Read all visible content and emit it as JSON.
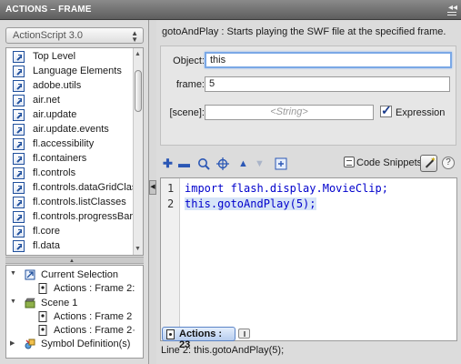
{
  "window": {
    "title": "ACTIONS – FRAME",
    "close_glyph": "◂◂",
    "menu_icon": "panel-menu-icon"
  },
  "left": {
    "language_select": {
      "value": "ActionScript 3.0"
    },
    "library": [
      {
        "label": "Top Level"
      },
      {
        "label": "Language Elements"
      },
      {
        "label": "adobe.utils"
      },
      {
        "label": "air.net"
      },
      {
        "label": "air.update"
      },
      {
        "label": "air.update.events"
      },
      {
        "label": "fl.accessibility"
      },
      {
        "label": "fl.containers"
      },
      {
        "label": "fl.controls"
      },
      {
        "label": "fl.controls.dataGridClas"
      },
      {
        "label": "fl.controls.listClasses"
      },
      {
        "label": "fl.controls.progressBar"
      },
      {
        "label": "fl.core"
      },
      {
        "label": "fl.data"
      }
    ],
    "script_navigator": {
      "current_selection": "Current Selection",
      "current_item": "Actions : Frame 2:",
      "scene": "Scene 1",
      "scene_items": [
        "Actions : Frame 2",
        "Actions : Frame 2·"
      ],
      "symbols": "Symbol Definition(s)"
    }
  },
  "right": {
    "description": "gotoAndPlay : Starts playing the SWF file at the specified frame.",
    "params": {
      "object_label": "Object:",
      "object_value": "this",
      "frame_label": "frame:",
      "frame_value": "5",
      "scene_label": "[scene]:",
      "scene_placeholder": "<String>",
      "expression_label": "Expression",
      "expression_checked": true
    },
    "toolbar": {
      "add_icon": "add-statement-icon",
      "remove_icon": "remove-statement-icon",
      "find_icon": "find-icon",
      "target_icon": "insert-target-path-icon",
      "up_icon": "move-up-icon",
      "down_icon": "move-down-icon",
      "script_assist_icon": "script-assist-icon",
      "snippets_label": "Code Snippets"
    },
    "code": {
      "lines": [
        {
          "num": "1",
          "text": "import flash.display.MovieClip;"
        },
        {
          "num": "2",
          "text": "this.gotoAndPlay(5);"
        }
      ]
    },
    "tab_label": "Actions : 23",
    "status_line": "Line 2: this.gotoAndPlay(5);"
  },
  "colors": {
    "keyword": "#0000cc",
    "selection": "#d6e4f7",
    "focus": "#7aa8e6"
  }
}
